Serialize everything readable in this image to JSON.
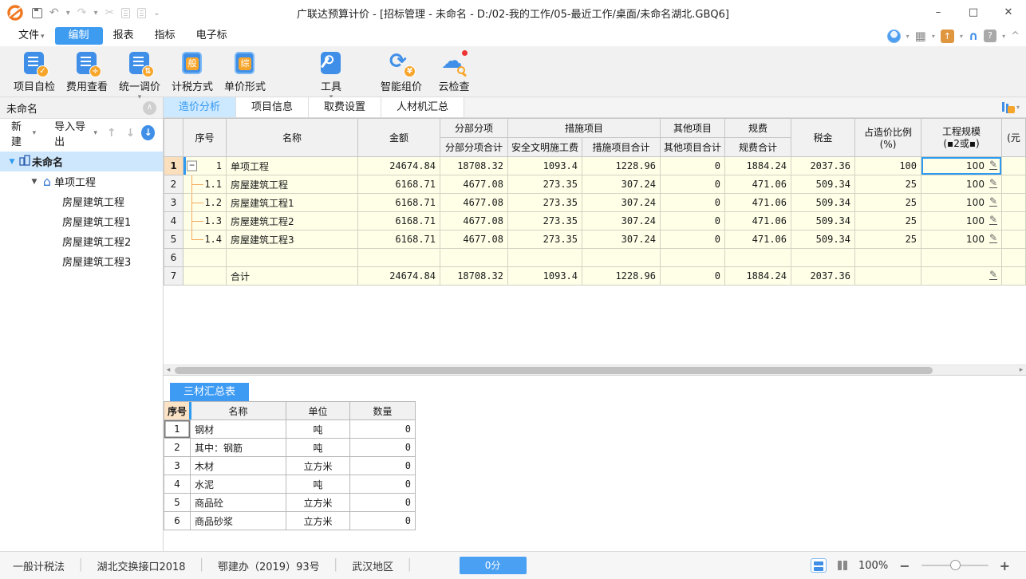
{
  "titlebar": {
    "title": "广联达预算计价 - [招标管理 - 未命名 - D:/02-我的工作/05-最近工作/桌面/未命名湖北.GBQ6]",
    "controls": {
      "minimize": "–",
      "maximize": "□",
      "close": "✕"
    }
  },
  "menubar": {
    "items": [
      {
        "label": "文件",
        "dropdown": true
      },
      {
        "label": "编制",
        "active": true
      },
      {
        "label": "报表"
      },
      {
        "label": "指标"
      },
      {
        "label": "电子标"
      }
    ]
  },
  "ribbon": {
    "buttons": [
      {
        "label": "项目自检"
      },
      {
        "label": "费用查看"
      },
      {
        "label": "统一调价",
        "dropdown": true
      },
      {
        "label": "计税方式",
        "chip": "般"
      },
      {
        "label": "单价形式",
        "chip": "综"
      },
      {
        "label": "工具",
        "dropdown": true
      },
      {
        "label": "智能组价"
      },
      {
        "label": "云检查"
      }
    ]
  },
  "sidebar": {
    "title": "未命名",
    "new_label": "新建",
    "import_export_label": "导入导出",
    "tree": [
      {
        "label": "未命名",
        "level": 0,
        "icon": "building",
        "expander": true,
        "selected": true
      },
      {
        "label": "单项工程",
        "level": 1,
        "icon": "house",
        "expander": true
      },
      {
        "label": "房屋建筑工程",
        "level": 2
      },
      {
        "label": "房屋建筑工程1",
        "level": 2
      },
      {
        "label": "房屋建筑工程2",
        "level": 2
      },
      {
        "label": "房屋建筑工程3",
        "level": 2
      }
    ]
  },
  "main": {
    "tabs": [
      {
        "label": "造价分析",
        "active": true
      },
      {
        "label": "项目信息"
      },
      {
        "label": "取费设置"
      },
      {
        "label": "人材机汇总"
      }
    ],
    "table": {
      "headers": {
        "seq": "序号",
        "name": "名称",
        "amount": "金额",
        "g_fbfx": "分部分项",
        "g_csxm": "措施项目",
        "g_qtxm": "其他项目",
        "g_gf": "规费",
        "s_fbfx": "分部分项合计",
        "s_aqwm": "安全文明施工费",
        "s_cshj": "措施项目合计",
        "s_qthj": "其他项目合计",
        "s_gfhj": "规费合计",
        "tax": "税金",
        "ratio1": "占造价比例",
        "ratio2": "(%)",
        "scale1": "工程规模",
        "scale2": "(▪2或▪)",
        "partial": "(元"
      },
      "rows": [
        {
          "n": "1",
          "seq": "1",
          "name": "单项工程",
          "values": [
            "24674.84",
            "18708.32",
            "1093.4",
            "1228.96",
            "0",
            "1884.24",
            "2037.36",
            "100"
          ],
          "scale": "100",
          "tree": "root",
          "current": true
        },
        {
          "n": "2",
          "seq": "1.1",
          "name": "房屋建筑工程",
          "values": [
            "6168.71",
            "4677.08",
            "273.35",
            "307.24",
            "0",
            "471.06",
            "509.34",
            "25"
          ],
          "scale": "100",
          "tree": "branch"
        },
        {
          "n": "3",
          "seq": "1.2",
          "name": "房屋建筑工程1",
          "values": [
            "6168.71",
            "4677.08",
            "273.35",
            "307.24",
            "0",
            "471.06",
            "509.34",
            "25"
          ],
          "scale": "100",
          "tree": "branch"
        },
        {
          "n": "4",
          "seq": "1.3",
          "name": "房屋建筑工程2",
          "values": [
            "6168.71",
            "4677.08",
            "273.35",
            "307.24",
            "0",
            "471.06",
            "509.34",
            "25"
          ],
          "scale": "100",
          "tree": "branch"
        },
        {
          "n": "5",
          "seq": "1.4",
          "name": "房屋建筑工程3",
          "values": [
            "6168.71",
            "4677.08",
            "273.35",
            "307.24",
            "0",
            "471.06",
            "509.34",
            "25"
          ],
          "scale": "100",
          "tree": "branch-last"
        },
        {
          "n": "6",
          "seq": "",
          "name": "",
          "values": [
            "",
            "",
            "",
            "",
            "",
            "",
            "",
            ""
          ],
          "scale": null,
          "tree": ""
        },
        {
          "n": "7",
          "seq": "",
          "name": "合计",
          "values": [
            "24674.84",
            "18708.32",
            "1093.4",
            "1228.96",
            "0",
            "1884.24",
            "2037.36",
            ""
          ],
          "scale": "",
          "tree": ""
        }
      ]
    }
  },
  "bottom": {
    "tab": "三材汇总表",
    "headers": [
      "序号",
      "名称",
      "单位",
      "数量"
    ],
    "rows": [
      [
        "1",
        "钢材",
        "吨",
        "0"
      ],
      [
        "2",
        "其中：钢筋",
        "吨",
        "0"
      ],
      [
        "3",
        "木材",
        "立方米",
        "0"
      ],
      [
        "4",
        "水泥",
        "吨",
        "0"
      ],
      [
        "5",
        "商品砼",
        "立方米",
        "0"
      ],
      [
        "6",
        "商品砂浆",
        "立方米",
        "0"
      ]
    ]
  },
  "statusbar": {
    "items": [
      "一般计税法",
      "湖北交换接口2018",
      "鄂建办（2019）93号",
      "武汉地区"
    ],
    "score": "0分",
    "zoom_level": "100%"
  },
  "icons": {
    "check": "✓",
    "divide": "÷",
    "updown": "⇅",
    "yen": "¥",
    "cycle": "⟳",
    "cloud": "☁",
    "pencil": "✎",
    "caret": "▾",
    "undo": "↶",
    "redo": "↷",
    "cut": "✂",
    "minus_box": "−",
    "up": "↑",
    "down": "↓",
    "left_tri": "◂",
    "right_tri": "▸",
    "collapse": "∧",
    "question": "?",
    "grid": "▦",
    "headset": "∩",
    "house": "⌂"
  },
  "colors": {
    "accent": "#3d9bf0",
    "tab_active_bg": "#cde9ff",
    "cell_bg": "#ffffe8",
    "peach": "#fce3c5",
    "header_bg": "#f1f1f1",
    "orange_badge": "#f7a52a",
    "tree_line": "#f2a95c",
    "score_btn": "#4aa0f2"
  }
}
